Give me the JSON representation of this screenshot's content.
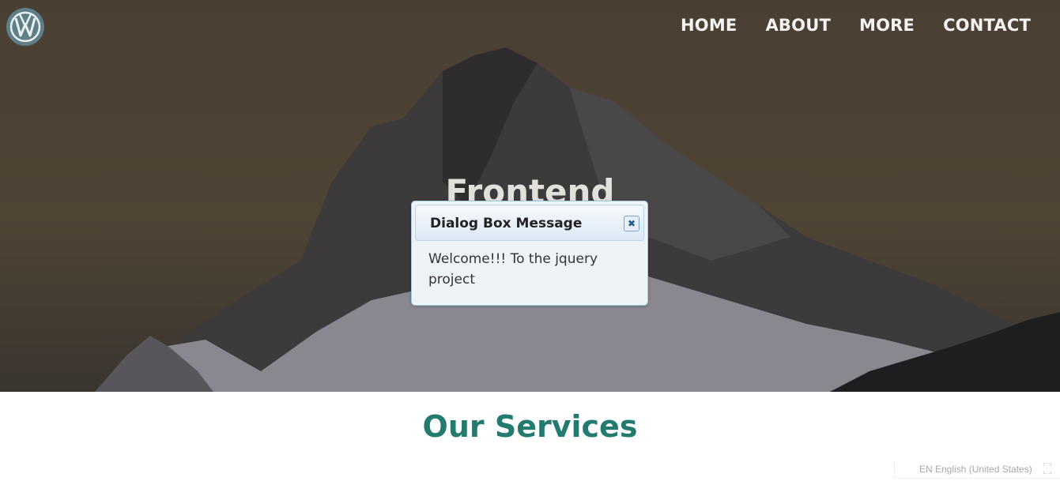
{
  "nav": {
    "items": [
      {
        "label": "HOME"
      },
      {
        "label": "ABOUT"
      },
      {
        "label": "MORE"
      },
      {
        "label": "CONTACT"
      }
    ],
    "logo_icon": "vw-logo-icon"
  },
  "hero": {
    "title": "Frontend"
  },
  "dialog": {
    "title": "Dialog Box Message",
    "close_icon": "close-icon",
    "body": "Welcome!!! To the jquery project"
  },
  "services": {
    "title": "Our Services"
  },
  "language_bar": {
    "label": "EN English (United States)"
  },
  "colors": {
    "accent": "#237a6e",
    "dialog_border": "#a6c9e2",
    "nav_text": "#f3f3f3"
  }
}
